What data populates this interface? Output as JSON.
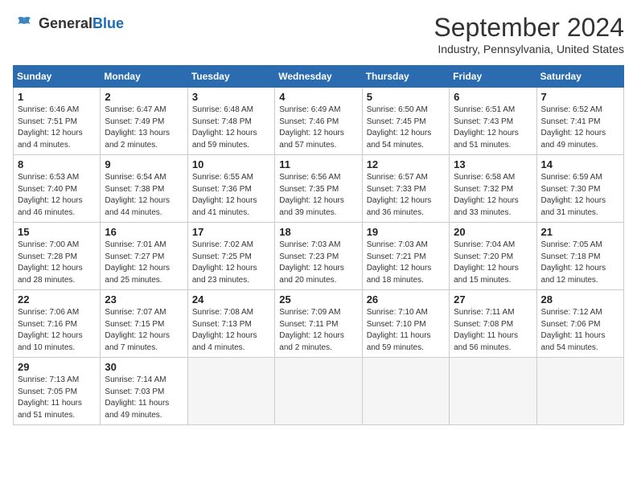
{
  "logo": {
    "general": "General",
    "blue": "Blue"
  },
  "header": {
    "month": "September 2024",
    "location": "Industry, Pennsylvania, United States"
  },
  "days_of_week": [
    "Sunday",
    "Monday",
    "Tuesday",
    "Wednesday",
    "Thursday",
    "Friday",
    "Saturday"
  ],
  "weeks": [
    [
      {
        "day": 1,
        "sunrise": "6:46 AM",
        "sunset": "7:51 PM",
        "daylight": "12 hours and 4 minutes."
      },
      {
        "day": 2,
        "sunrise": "6:47 AM",
        "sunset": "7:49 PM",
        "daylight": "13 hours and 2 minutes."
      },
      {
        "day": 3,
        "sunrise": "6:48 AM",
        "sunset": "7:48 PM",
        "daylight": "12 hours and 59 minutes."
      },
      {
        "day": 4,
        "sunrise": "6:49 AM",
        "sunset": "7:46 PM",
        "daylight": "12 hours and 57 minutes."
      },
      {
        "day": 5,
        "sunrise": "6:50 AM",
        "sunset": "7:45 PM",
        "daylight": "12 hours and 54 minutes."
      },
      {
        "day": 6,
        "sunrise": "6:51 AM",
        "sunset": "7:43 PM",
        "daylight": "12 hours and 51 minutes."
      },
      {
        "day": 7,
        "sunrise": "6:52 AM",
        "sunset": "7:41 PM",
        "daylight": "12 hours and 49 minutes."
      }
    ],
    [
      {
        "day": 8,
        "sunrise": "6:53 AM",
        "sunset": "7:40 PM",
        "daylight": "12 hours and 46 minutes."
      },
      {
        "day": 9,
        "sunrise": "6:54 AM",
        "sunset": "7:38 PM",
        "daylight": "12 hours and 44 minutes."
      },
      {
        "day": 10,
        "sunrise": "6:55 AM",
        "sunset": "7:36 PM",
        "daylight": "12 hours and 41 minutes."
      },
      {
        "day": 11,
        "sunrise": "6:56 AM",
        "sunset": "7:35 PM",
        "daylight": "12 hours and 39 minutes."
      },
      {
        "day": 12,
        "sunrise": "6:57 AM",
        "sunset": "7:33 PM",
        "daylight": "12 hours and 36 minutes."
      },
      {
        "day": 13,
        "sunrise": "6:58 AM",
        "sunset": "7:32 PM",
        "daylight": "12 hours and 33 minutes."
      },
      {
        "day": 14,
        "sunrise": "6:59 AM",
        "sunset": "7:30 PM",
        "daylight": "12 hours and 31 minutes."
      }
    ],
    [
      {
        "day": 15,
        "sunrise": "7:00 AM",
        "sunset": "7:28 PM",
        "daylight": "12 hours and 28 minutes."
      },
      {
        "day": 16,
        "sunrise": "7:01 AM",
        "sunset": "7:27 PM",
        "daylight": "12 hours and 25 minutes."
      },
      {
        "day": 17,
        "sunrise": "7:02 AM",
        "sunset": "7:25 PM",
        "daylight": "12 hours and 23 minutes."
      },
      {
        "day": 18,
        "sunrise": "7:03 AM",
        "sunset": "7:23 PM",
        "daylight": "12 hours and 20 minutes."
      },
      {
        "day": 19,
        "sunrise": "7:03 AM",
        "sunset": "7:21 PM",
        "daylight": "12 hours and 18 minutes."
      },
      {
        "day": 20,
        "sunrise": "7:04 AM",
        "sunset": "7:20 PM",
        "daylight": "12 hours and 15 minutes."
      },
      {
        "day": 21,
        "sunrise": "7:05 AM",
        "sunset": "7:18 PM",
        "daylight": "12 hours and 12 minutes."
      }
    ],
    [
      {
        "day": 22,
        "sunrise": "7:06 AM",
        "sunset": "7:16 PM",
        "daylight": "12 hours and 10 minutes."
      },
      {
        "day": 23,
        "sunrise": "7:07 AM",
        "sunset": "7:15 PM",
        "daylight": "12 hours and 7 minutes."
      },
      {
        "day": 24,
        "sunrise": "7:08 AM",
        "sunset": "7:13 PM",
        "daylight": "12 hours and 4 minutes."
      },
      {
        "day": 25,
        "sunrise": "7:09 AM",
        "sunset": "7:11 PM",
        "daylight": "12 hours and 2 minutes."
      },
      {
        "day": 26,
        "sunrise": "7:10 AM",
        "sunset": "7:10 PM",
        "daylight": "11 hours and 59 minutes."
      },
      {
        "day": 27,
        "sunrise": "7:11 AM",
        "sunset": "7:08 PM",
        "daylight": "11 hours and 56 minutes."
      },
      {
        "day": 28,
        "sunrise": "7:12 AM",
        "sunset": "7:06 PM",
        "daylight": "11 hours and 54 minutes."
      }
    ],
    [
      {
        "day": 29,
        "sunrise": "7:13 AM",
        "sunset": "7:05 PM",
        "daylight": "11 hours and 51 minutes."
      },
      {
        "day": 30,
        "sunrise": "7:14 AM",
        "sunset": "7:03 PM",
        "daylight": "11 hours and 49 minutes."
      },
      null,
      null,
      null,
      null,
      null
    ]
  ]
}
